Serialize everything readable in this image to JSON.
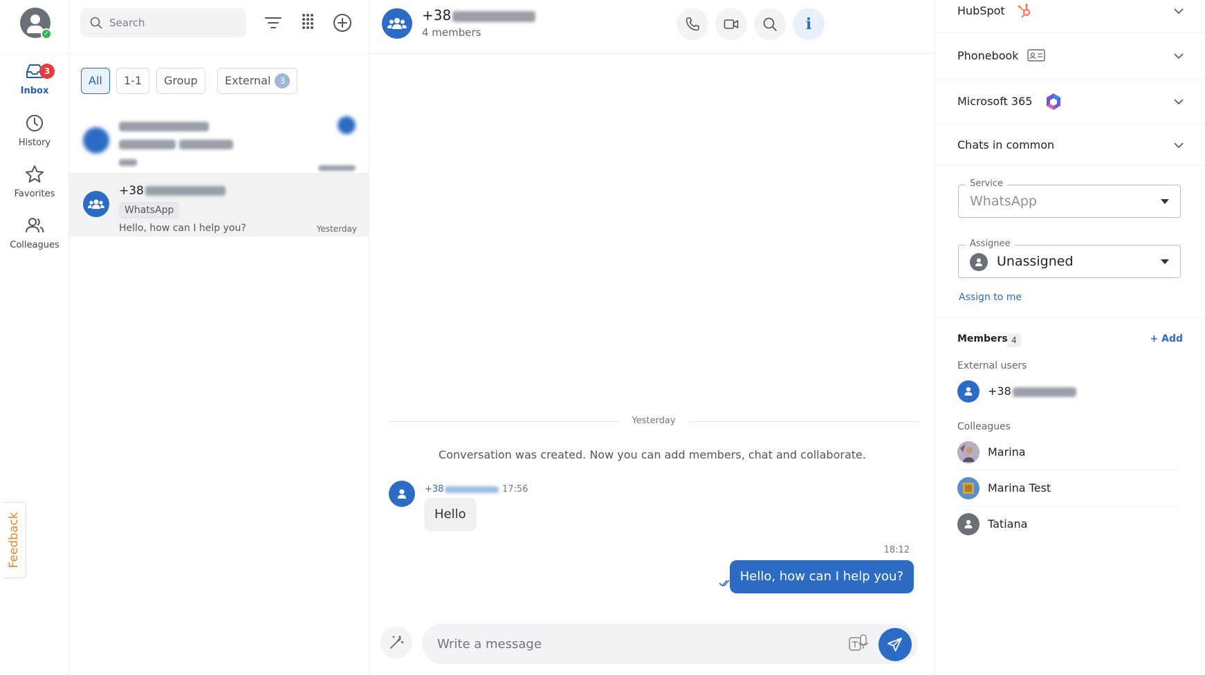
{
  "rail": {
    "items": [
      {
        "label": "Inbox",
        "badge": "3",
        "icon": "inbox-icon"
      },
      {
        "label": "History",
        "icon": "clock-icon"
      },
      {
        "label": "Favorites",
        "icon": "star-icon"
      },
      {
        "label": "Colleagues",
        "icon": "people-icon"
      }
    ],
    "feedback": "Feedback"
  },
  "list": {
    "search_placeholder": "Search",
    "filters": [
      {
        "label": "All",
        "active": true
      },
      {
        "label": "1-1"
      },
      {
        "label": "Group"
      },
      {
        "label": "External",
        "count": "3"
      }
    ],
    "conversations": [
      {
        "title": "+38",
        "tag": "WhatsApp",
        "preview": "Hello, how can I help you?",
        "time": "Yesterday",
        "selected": true
      }
    ]
  },
  "chat": {
    "title": "+38",
    "subtitle": "4 members",
    "day": "Yesterday",
    "system": "Conversation was created. Now you can add members, chat and collaborate.",
    "incoming": {
      "sender": "+38",
      "time": "17:56",
      "text": "Hello"
    },
    "outgoing": {
      "time": "18:12",
      "text": "Hello, how can I help you?"
    },
    "composer_placeholder": "Write a message",
    "colors": {
      "accent": "#2c6cc4"
    }
  },
  "side": {
    "sections": [
      {
        "title": "HubSpot"
      },
      {
        "title": "Phonebook"
      },
      {
        "title": "Microsoft 365"
      },
      {
        "title": "Chats in common"
      }
    ],
    "service": {
      "label": "Service",
      "value": "WhatsApp"
    },
    "assignee": {
      "label": "Assignee",
      "value": "Unassigned"
    },
    "assign_me": "Assign to me",
    "members": {
      "title": "Members",
      "count": "4",
      "add": "+ Add",
      "external_label": "External users",
      "external": [
        {
          "name": "+38"
        }
      ],
      "colleagues_label": "Colleagues",
      "colleagues": [
        {
          "name": "Marina"
        },
        {
          "name": "Marina Test"
        },
        {
          "name": "Tatiana"
        }
      ]
    }
  }
}
